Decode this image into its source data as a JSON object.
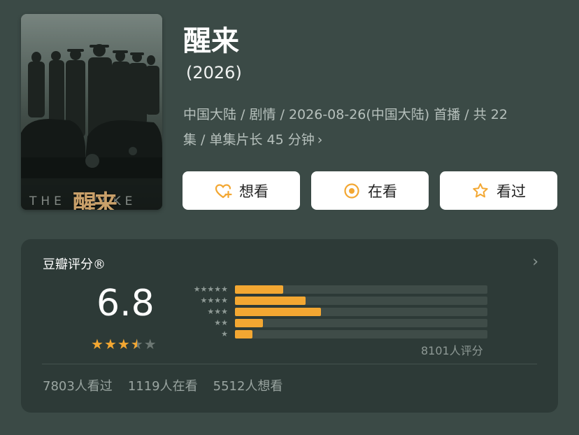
{
  "poster": {
    "title_en": "THE AWAKE",
    "title_cn": "醒来"
  },
  "title": "醒来",
  "year": "(2026)",
  "meta": {
    "line1": "中国大陆 / 剧情 / 2026-08-26(中国大陆) 首播 / 共 22",
    "line2": "集 / 单集片长 45 分钟",
    "chevron": "›"
  },
  "buttons": {
    "want": {
      "label": "想看",
      "icon": "heart-plus-icon"
    },
    "watching": {
      "label": "在看",
      "icon": "target-circle-icon"
    },
    "watched": {
      "label": "看过",
      "icon": "star-outline-icon"
    }
  },
  "rating": {
    "title": "豆瓣评分®",
    "chevron": "›",
    "score": "6.8",
    "score_value": 6.8,
    "star_count": 3.5,
    "distribution": [
      {
        "stars": 5,
        "percent": 19
      },
      {
        "stars": 4,
        "percent": 28
      },
      {
        "stars": 3,
        "percent": 34
      },
      {
        "stars": 2,
        "percent": 11
      },
      {
        "stars": 1,
        "percent": 7
      }
    ],
    "count_text": "8101人评分",
    "stats": {
      "watched": "7803人看过",
      "watching": "1119人在看",
      "want": "5512人想看"
    }
  },
  "colors": {
    "background": "#3b4a46",
    "card": "#2d3a37",
    "accent": "#f3a732",
    "button": "#ffffff"
  }
}
